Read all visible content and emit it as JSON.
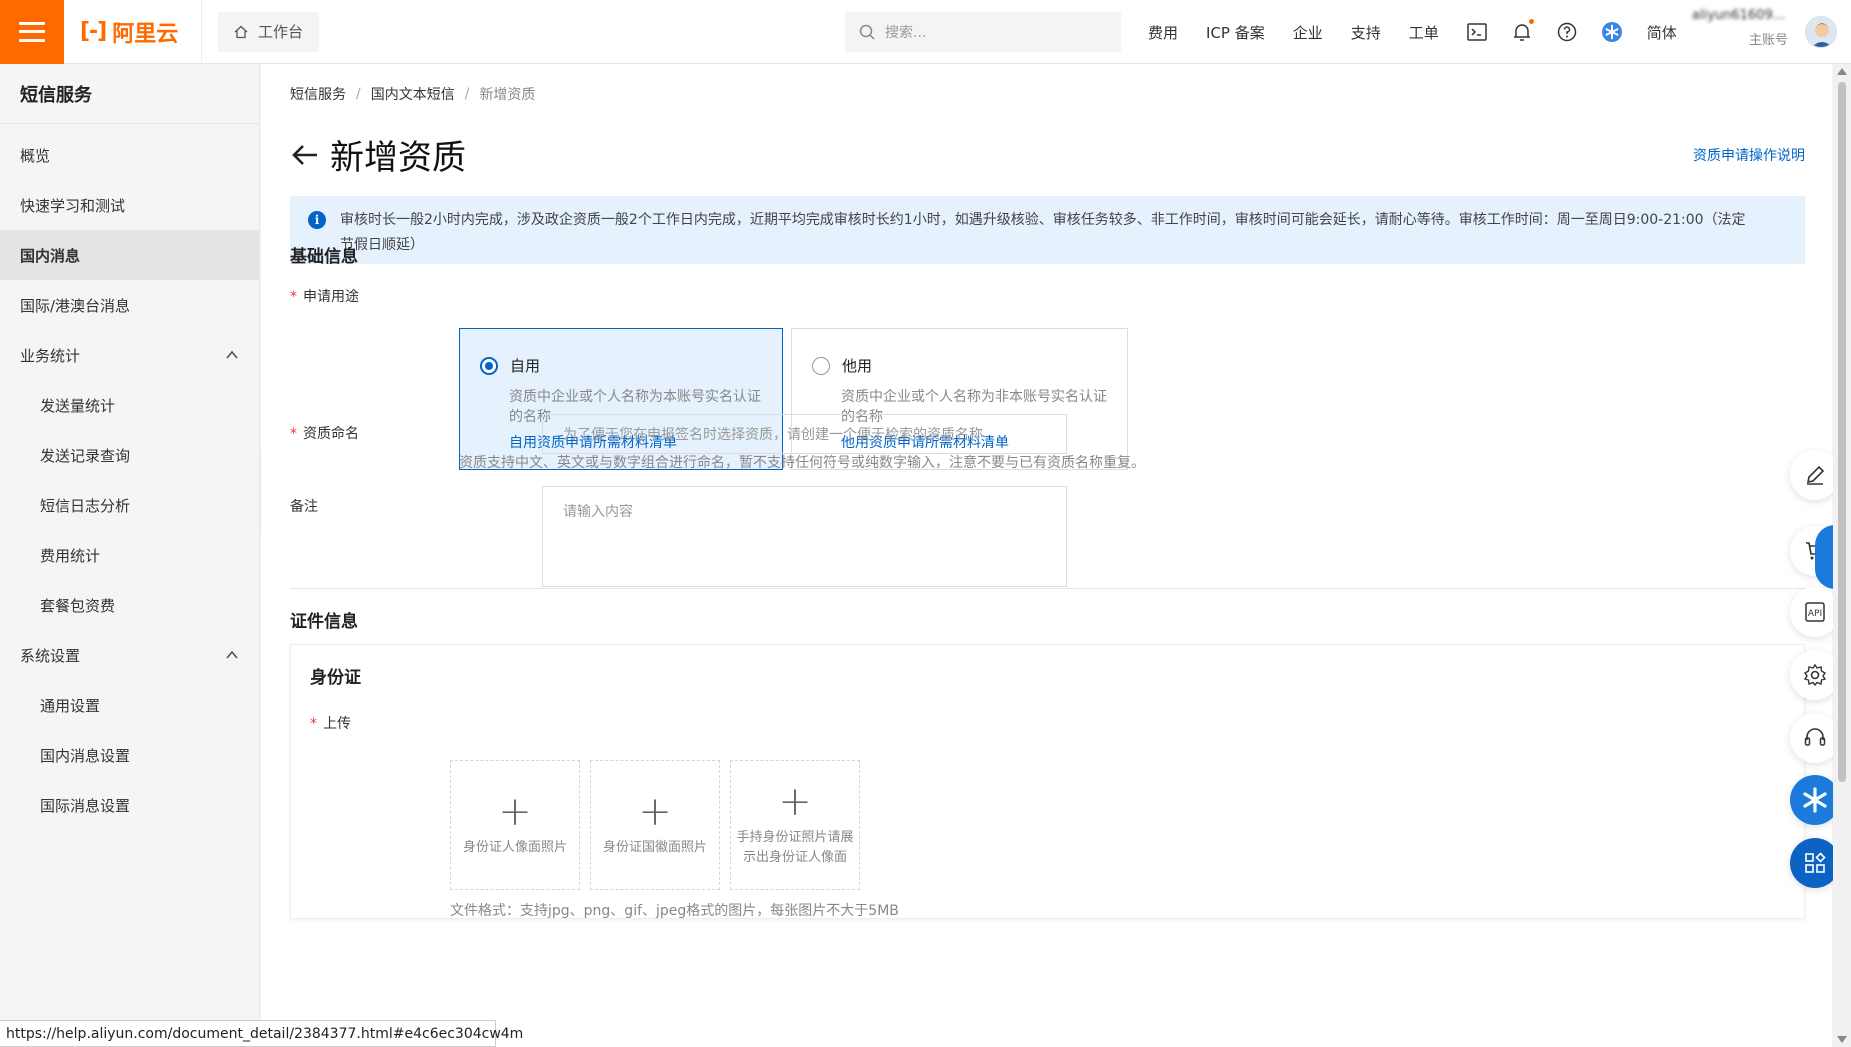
{
  "topbar": {
    "brand": "阿里云",
    "workbench": "工作台",
    "search_placeholder": "搜索...",
    "links": [
      "费用",
      "ICP 备案",
      "企业",
      "支持",
      "工单"
    ],
    "language": "简体",
    "username": "aliyun61609...",
    "role": "主账号"
  },
  "sidebar": {
    "title": "短信服务",
    "items": [
      {
        "label": "概览"
      },
      {
        "label": "快速学习和测试"
      },
      {
        "label": "国内消息"
      },
      {
        "label": "国际/港澳台消息"
      },
      {
        "label": "业务统计"
      },
      {
        "label": "发送量统计"
      },
      {
        "label": "发送记录查询"
      },
      {
        "label": "短信日志分析"
      },
      {
        "label": "费用统计"
      },
      {
        "label": "套餐包资费"
      },
      {
        "label": "系统设置"
      },
      {
        "label": "通用设置"
      },
      {
        "label": "国内消息设置"
      },
      {
        "label": "国际消息设置"
      }
    ]
  },
  "breadcrumb": [
    "短信服务",
    "国内文本短信",
    "新增资质"
  ],
  "page": {
    "title": "新增资质",
    "help_link": "资质申请操作说明",
    "notice": "审核时长一般2小时内完成，涉及政企资质一般2个工作日内完成，近期平均完成审核时长约1小时，如遇升级核验、审核任务较多、非工作时间，审核时间可能会延长，请耐心等待。审核工作时间：周一至周日9:00-21:00（法定节假日顺延）"
  },
  "basic": {
    "section_title": "基础信息",
    "usage_label": "申请用途",
    "options": [
      {
        "title": "自用",
        "desc": "资质中企业或个人名称为本账号实名认证的名称",
        "link": "自用资质申请所需材料清单",
        "selected": true
      },
      {
        "title": "他用",
        "desc": "资质中企业或个人名称为非本账号实名认证的名称",
        "link": "他用资质申请所需材料清单",
        "selected": false
      }
    ],
    "name_label": "资质命名",
    "name_placeholder": "为了便于您在申报签名时选择资质，请创建一个便于检索的资质名称",
    "name_hint": "资质支持中文、英文或与数字组合进行命名，暂不支持任何符号或纯数字输入，注意不要与已有资质名称重复。",
    "remark_label": "备注",
    "remark_placeholder": "请输入内容"
  },
  "cert": {
    "section_title": "证件信息",
    "id_title": "身份证",
    "upload_label": "上传",
    "uploads": [
      "身份证人像面照片",
      "身份证国徽面照片",
      "手持身份证照片请展示出身份证人像面"
    ],
    "format_hint": "文件格式：支持jpg、png、gif、jpeg格式的图片，每张图片不大于5MB"
  },
  "status_url": "https://help.aliyun.com/document_detail/2384377.html#e4c6ec304cw4m",
  "colors": {
    "brand": "#ff6a00",
    "link": "#0064c8",
    "notice_bg": "#e5f1fd"
  }
}
